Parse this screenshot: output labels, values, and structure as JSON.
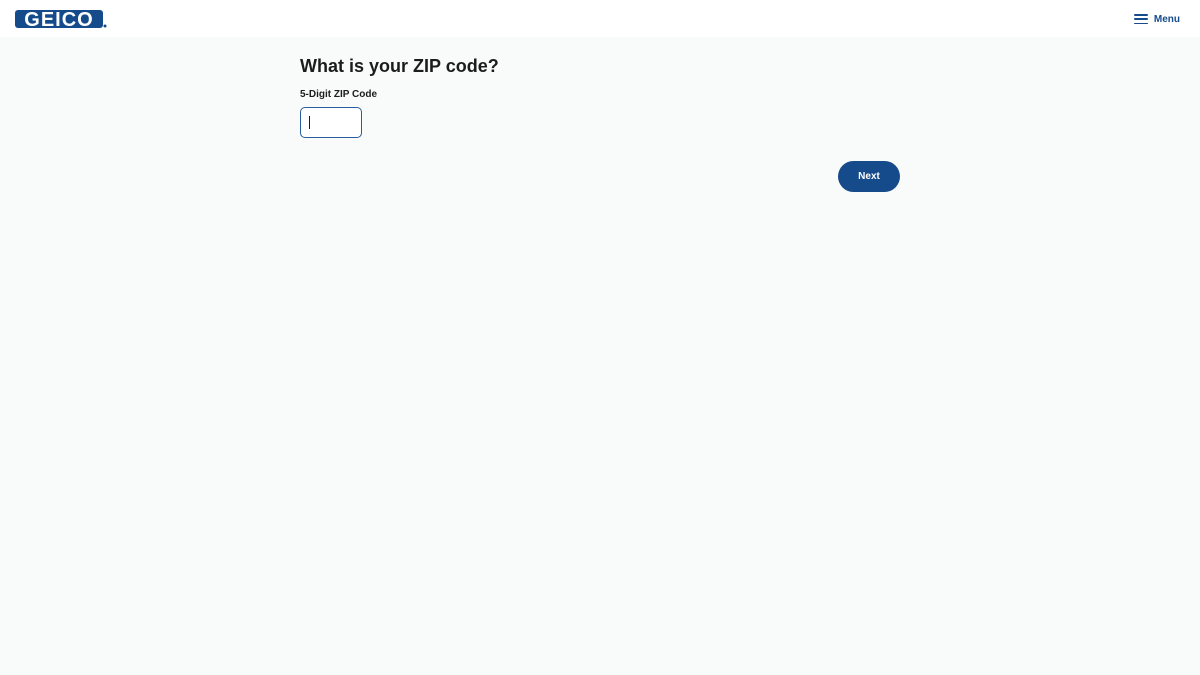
{
  "header": {
    "logo_text": "GEICO",
    "menu_label": "Menu"
  },
  "form": {
    "title": "What is your ZIP code?",
    "zip_label": "5-Digit ZIP Code",
    "zip_value": "",
    "next_label": "Next"
  },
  "colors": {
    "brand_blue": "#154b8b",
    "page_background": "#f9fafa"
  },
  "icons": {
    "menu": "hamburger-menu-icon"
  }
}
